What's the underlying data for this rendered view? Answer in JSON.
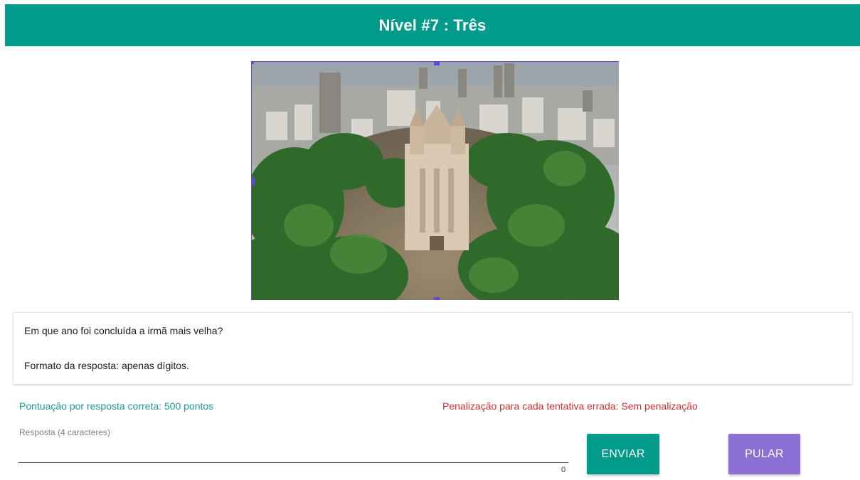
{
  "header": {
    "title": "Nível #7 : Três"
  },
  "puzzle_image": {
    "description_icon": "cathedral-aerial-photo"
  },
  "question": {
    "line1": "Em que ano foi concluída a irmã mais velha?",
    "line2": "Formato da resposta: apenas dígitos."
  },
  "scoring": {
    "score_text": "Pontuação por resposta correta: 500 pontos",
    "penalty_text": "Penalização para cada tentativa errada: Sem penalização"
  },
  "answer": {
    "label": "Resposta (4 caracteres)",
    "value": "",
    "char_count": "0"
  },
  "buttons": {
    "send_label": "ENVIAR",
    "skip_label": "PULAR"
  },
  "colors": {
    "primary": "#009b8a",
    "secondary": "#8c6fd5",
    "penalty": "#d32f2f"
  }
}
